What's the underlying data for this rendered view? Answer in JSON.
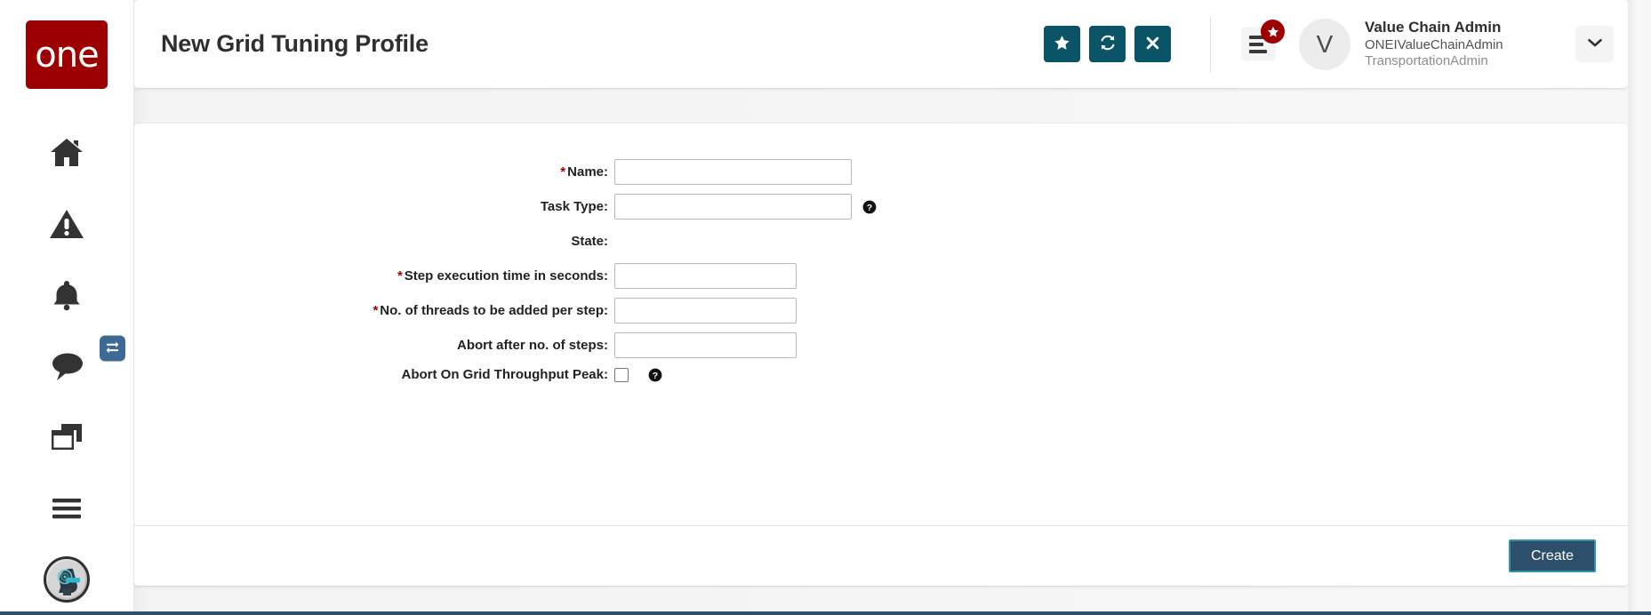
{
  "brand": {
    "logo_text": "one",
    "logo_color": "#9d0000"
  },
  "sidebar": {
    "items": [
      {
        "name": "home",
        "icon": "home-icon"
      },
      {
        "name": "alerts",
        "icon": "warning-triangle-icon"
      },
      {
        "name": "notifications",
        "icon": "bell-icon"
      },
      {
        "name": "messages",
        "icon": "chat-bubble-icon"
      },
      {
        "name": "workspaces",
        "icon": "windows-stack-icon"
      },
      {
        "name": "menu",
        "icon": "hamburger-icon"
      },
      {
        "name": "assistant",
        "icon": "ai-assistant-avatar-icon"
      }
    ],
    "toggle": {
      "icon": "exchange-arrows-icon",
      "color": "#3d6a94"
    }
  },
  "header": {
    "title": "New Grid Tuning Profile",
    "actions": [
      {
        "name": "favorite",
        "icon": "star-icon",
        "color": "#0b5468"
      },
      {
        "name": "refresh",
        "icon": "refresh-icon",
        "color": "#0b5468"
      },
      {
        "name": "close",
        "icon": "close-x-icon",
        "color": "#0b5468"
      }
    ],
    "menu_button": {
      "icon": "list-menu-icon",
      "badge_icon": "star-icon",
      "badge_color": "#9d0000"
    },
    "user": {
      "avatar_initial": "V",
      "name": "Value Chain Admin",
      "login": "ONEIValueChainAdmin",
      "role": "TransportationAdmin"
    },
    "caret": {
      "icon": "chevron-down-icon"
    }
  },
  "form": {
    "fields": [
      {
        "label": "Name:",
        "required": true,
        "type": "text",
        "value": "",
        "width": "wide",
        "help": false
      },
      {
        "label": "Task Type:",
        "required": false,
        "type": "text",
        "value": "",
        "width": "wide",
        "help": true
      },
      {
        "label": "State:",
        "required": false,
        "type": "readonly",
        "value": "",
        "help": false
      },
      {
        "label": "Step execution time in seconds:",
        "required": true,
        "type": "text",
        "value": "",
        "width": "narrow",
        "help": false
      },
      {
        "label": "No. of threads to be added per step:",
        "required": true,
        "type": "text",
        "value": "",
        "width": "narrow",
        "help": false
      },
      {
        "label": "Abort after no. of steps:",
        "required": false,
        "type": "text",
        "value": "",
        "width": "narrow",
        "help": false
      },
      {
        "label": "Abort On Grid Throughput Peak:",
        "required": false,
        "type": "checkbox",
        "checked": false,
        "help": true
      }
    ],
    "required_marker": "*"
  },
  "footer": {
    "create_label": "Create",
    "create_bg": "#2d4f6b",
    "create_border": "#2e94aa"
  }
}
